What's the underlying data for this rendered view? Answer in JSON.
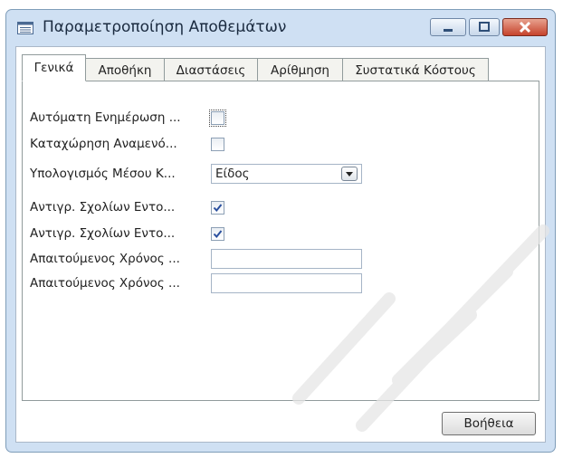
{
  "window": {
    "title": "Παραμετροποίηση Αποθεμάτων",
    "accent": "#cfe0f3",
    "close_color": "#c6432c"
  },
  "tabs": [
    {
      "label": "Γενικά",
      "active": true
    },
    {
      "label": "Αποθήκη",
      "active": false
    },
    {
      "label": "Διαστάσεις",
      "active": false
    },
    {
      "label": "Αρίθμηση",
      "active": false
    },
    {
      "label": "Συστατικά Κόστους",
      "active": false
    }
  ],
  "fields": {
    "auto_update": {
      "label": "Αυτόματη Ενημέρωση ...",
      "checked": false
    },
    "expected_posting": {
      "label": "Καταχώρηση Αναμενό...",
      "checked": false
    },
    "avg_cost_calc": {
      "label": "Υπολογισμός Μέσου Κ...",
      "value": "Είδος"
    },
    "copy_comments_1": {
      "label": "Αντιγρ. Σχολίων Εντο...",
      "checked": true
    },
    "copy_comments_2": {
      "label": "Αντιγρ. Σχολίων Εντο...",
      "checked": true
    },
    "required_time_1": {
      "label": "Απαιτούμενος Χρόνος ...",
      "value": ""
    },
    "required_time_2": {
      "label": "Απαιτούμενος Χρόνος ...",
      "value": ""
    }
  },
  "buttons": {
    "help_label": "Βοήθεια"
  },
  "icons": {
    "window_icon": "form-icon",
    "combo_icon": "dropdown-arrow-icon"
  }
}
